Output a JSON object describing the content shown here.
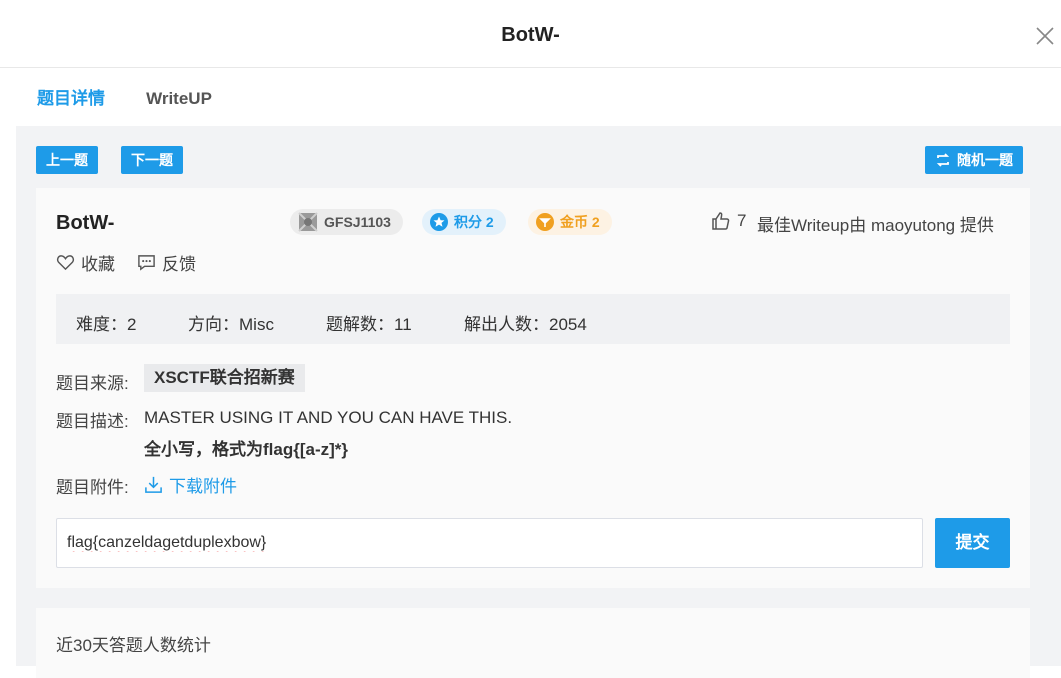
{
  "header": {
    "title": "BotW-"
  },
  "tabs": [
    {
      "label": "题目详情",
      "active": true
    },
    {
      "label": "WriteUP",
      "active": false
    }
  ],
  "nav": {
    "prev_label": "上一题",
    "next_label": "下一题",
    "random_label": "随机一题"
  },
  "challenge": {
    "name": "BotW-",
    "id_badge": "GFSJ1103",
    "score_badge": "积分 2",
    "coin_badge": "金币 2",
    "likes": "7",
    "best_writeup": "最佳Writeup由 maoyutong 提供",
    "favorite_label": "收藏",
    "feedback_label": "反馈"
  },
  "stats": {
    "difficulty": "难度：2",
    "direction": "方向：Misc",
    "writeups": "题解数：11",
    "solvers": "解出人数：2054"
  },
  "details": {
    "source_label": "题目来源:",
    "source_value": "XSCTF联合招新赛",
    "desc_label": "题目描述:",
    "desc_line1": "MASTER USING IT AND YOU CAN HAVE THIS.",
    "desc_line2": "全小写，格式为flag{[a-z]*}",
    "attach_label": "题目附件:",
    "attach_link": "下载附件"
  },
  "submit": {
    "flag_value": "flag{canzeldagetduplexbow}",
    "submit_label": "提交"
  },
  "stats_card": {
    "title": "近30天答题人数统计"
  },
  "colors": {
    "accent": "#1e9be8",
    "gold": "#f0a020"
  }
}
